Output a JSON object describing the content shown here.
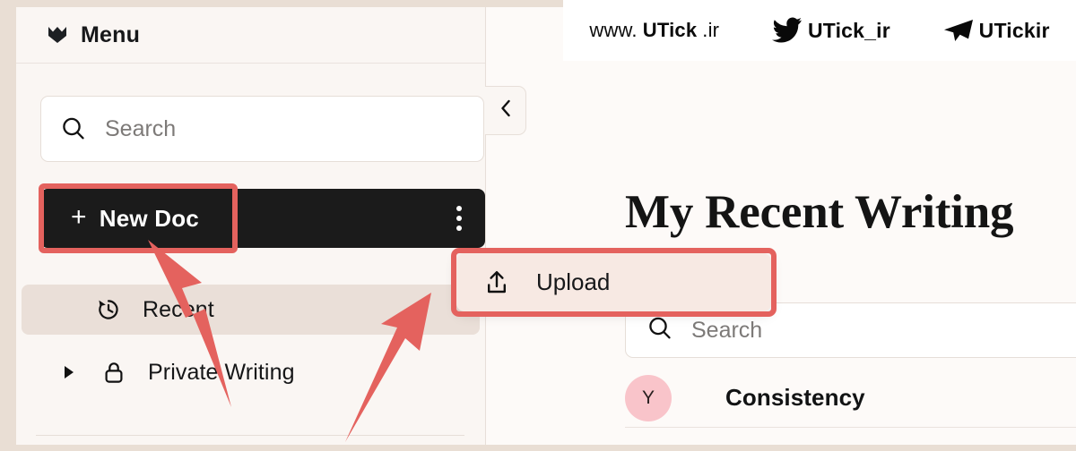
{
  "watermark": {
    "site": {
      "prefix": "www.",
      "brand": "UTick",
      "suffix": ".ir"
    },
    "twitter": {
      "icon": "twitter-bird-icon",
      "handle": "UTick_ir"
    },
    "telegram": {
      "icon": "telegram-plane-icon",
      "handle": "UTickir"
    }
  },
  "sidebar": {
    "brand": {
      "icon": "chevron-logo-icon",
      "label": "Menu"
    },
    "search": {
      "icon": "search-icon",
      "placeholder": "Search",
      "value": ""
    },
    "new_doc": {
      "icon": "plus-icon",
      "label": "New Doc",
      "menu_icon": "kebab-menu-icon"
    },
    "items": [
      {
        "icon": "history-clock-icon",
        "label": "Recent",
        "selected": true
      },
      {
        "icon": "lock-icon",
        "caret": "caret-right-icon",
        "label": "Private Writing",
        "selected": false
      }
    ]
  },
  "collapse": {
    "icon": "chevron-left-icon"
  },
  "dropdown": {
    "items": [
      {
        "icon": "upload-icon",
        "label": "Upload"
      }
    ]
  },
  "main": {
    "title": "My Recent Writing",
    "search": {
      "icon": "search-icon",
      "placeholder": "Search",
      "value": ""
    },
    "documents": [
      {
        "avatar_letter": "Y",
        "title": "Consistency"
      }
    ]
  },
  "annotations": {
    "highlight_color": "#e4625e",
    "arrow_color": "#e4625e",
    "arrows": [
      {
        "name": "arrow-to-new-doc",
        "points_to": "New Doc"
      },
      {
        "name": "arrow-to-upload",
        "points_to": "Upload"
      }
    ]
  },
  "colors": {
    "page_background": "#e9ded4",
    "sidebar_background": "#faf6f3",
    "main_background": "#fdfaf8",
    "dark_button": "#1b1b1b",
    "selected_item": "#eadfd8",
    "dropdown_background": "#f7e9e3",
    "avatar_background": "#f9c4ca",
    "accent_red": "#e4625e"
  }
}
